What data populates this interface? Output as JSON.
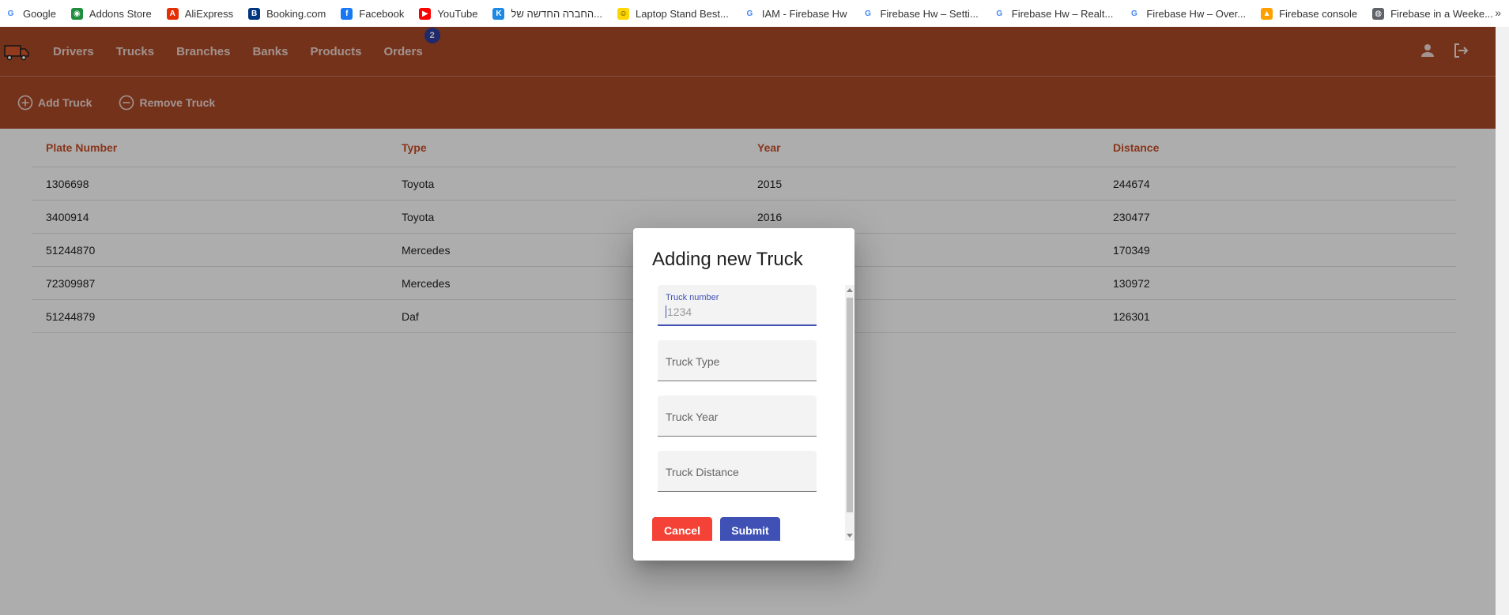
{
  "bookmarks": [
    {
      "label": "Google",
      "icon": "google-icon",
      "color": "#4285f4"
    },
    {
      "label": "Addons Store",
      "icon": "addons-store-icon",
      "color": "#1e8e3e"
    },
    {
      "label": "AliExpress",
      "icon": "aliexpress-icon",
      "color": "#e62e04"
    },
    {
      "label": "Booking.com",
      "icon": "booking-icon",
      "color": "#003580"
    },
    {
      "label": "Facebook",
      "icon": "facebook-icon",
      "color": "#1877f2"
    },
    {
      "label": "YouTube",
      "icon": "youtube-icon",
      "color": "#ff0000"
    },
    {
      "label": "החברה החדשה של...",
      "icon": "news-site-icon",
      "color": "#1e88e5"
    },
    {
      "label": "Laptop Stand Best...",
      "icon": "smiley-icon",
      "color": "#ffd600"
    },
    {
      "label": "IAM - Firebase Hw",
      "icon": "google-icon",
      "color": "#4285f4"
    },
    {
      "label": "Firebase Hw – Setti...",
      "icon": "google-icon",
      "color": "#4285f4"
    },
    {
      "label": "Firebase Hw – Realt...",
      "icon": "google-icon",
      "color": "#4285f4"
    },
    {
      "label": "Firebase Hw – Over...",
      "icon": "google-icon",
      "color": "#4285f4"
    },
    {
      "label": "Firebase console",
      "icon": "firebase-icon",
      "color": "#ffa000"
    },
    {
      "label": "Firebase in a Weeke...",
      "icon": "globe-icon",
      "color": "#5f6368"
    }
  ],
  "bookmarks_more": "»",
  "nav": {
    "items": [
      "Drivers",
      "Trucks",
      "Branches",
      "Banks",
      "Products",
      "Orders"
    ],
    "orders_badge": "2"
  },
  "toolbar": {
    "add_label": "Add Truck",
    "remove_label": "Remove Truck"
  },
  "table": {
    "headers": [
      "Plate Number",
      "Type",
      "Year",
      "Distance"
    ],
    "rows": [
      [
        "1306698",
        "Toyota",
        "2015",
        "244674"
      ],
      [
        "3400914",
        "Toyota",
        "2016",
        "230477"
      ],
      [
        "51244870",
        "Mercedes",
        "",
        "170349"
      ],
      [
        "72309987",
        "Mercedes",
        "",
        "130972"
      ],
      [
        "51244879",
        "Daf",
        "",
        "126301"
      ]
    ]
  },
  "dialog": {
    "title": "Adding new Truck",
    "fields": {
      "truck_number": {
        "label": "Truck number",
        "placeholder": "1234"
      },
      "truck_type": {
        "placeholder": "Truck Type"
      },
      "truck_year": {
        "placeholder": "Truck Year"
      },
      "truck_distance": {
        "placeholder": "Truck Distance"
      }
    },
    "cancel_label": "Cancel",
    "submit_label": "Submit"
  },
  "colors": {
    "appbar": "#ad4a28",
    "header_text": "#c9502a",
    "primary": "#3f51b5",
    "cancel": "#f44336"
  }
}
